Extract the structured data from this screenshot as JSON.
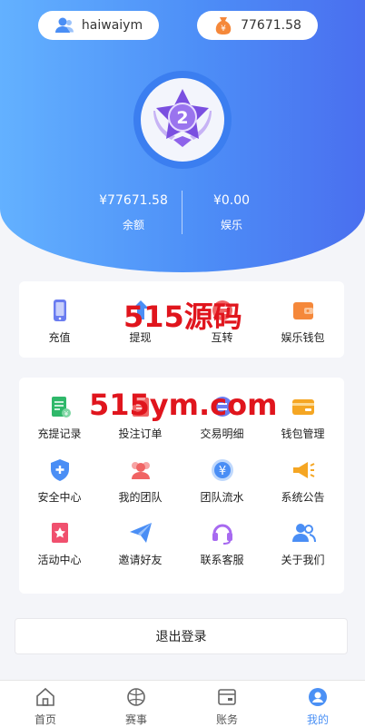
{
  "header": {
    "username": "haiwaiym",
    "balance": "77671.58"
  },
  "stats": {
    "balance_value": "¥77671.58",
    "balance_label": "余额",
    "ent_value": "¥0.00",
    "ent_label": "娱乐"
  },
  "medal": {
    "level": "2"
  },
  "quick_actions": [
    {
      "label": "充值",
      "icon": "phone-icon",
      "color": "#6a7cf0"
    },
    {
      "label": "提现",
      "icon": "withdraw-icon",
      "color": "#4a8ef5"
    },
    {
      "label": "互转",
      "icon": "transfer-icon",
      "color": "#f06464"
    },
    {
      "label": "娱乐钱包",
      "icon": "wallet-icon",
      "color": "#f5883a"
    }
  ],
  "menu": [
    {
      "label": "充提记录",
      "icon": "record-icon",
      "color": "#2fb86a"
    },
    {
      "label": "投注订单",
      "icon": "order-icon",
      "color": "#f06464"
    },
    {
      "label": "交易明细",
      "icon": "transaction-icon",
      "color": "#6a7cf0"
    },
    {
      "label": "钱包管理",
      "icon": "card-icon",
      "color": "#f5a623"
    },
    {
      "label": "安全中心",
      "icon": "shield-icon",
      "color": "#4a8ef5"
    },
    {
      "label": "我的团队",
      "icon": "team-icon",
      "color": "#f06464"
    },
    {
      "label": "团队流水",
      "icon": "yen-icon",
      "color": "#4a8ef5"
    },
    {
      "label": "系统公告",
      "icon": "megaphone-icon",
      "color": "#f5a623"
    },
    {
      "label": "活动中心",
      "icon": "ribbon-icon",
      "color": "#f0506e"
    },
    {
      "label": "邀请好友",
      "icon": "paper-plane-icon",
      "color": "#4a8ef5"
    },
    {
      "label": "联系客服",
      "icon": "headset-icon",
      "color": "#a76af0"
    },
    {
      "label": "关于我们",
      "icon": "users-icon",
      "color": "#4a8ef5"
    }
  ],
  "watermarks": {
    "top": "515源码",
    "middle": "515ym.com"
  },
  "logout_label": "退出登录",
  "tabs": [
    {
      "label": "首页",
      "icon": "home-icon"
    },
    {
      "label": "赛事",
      "icon": "ball-icon"
    },
    {
      "label": "账务",
      "icon": "ledger-icon"
    },
    {
      "label": "我的",
      "icon": "profile-icon",
      "active": true
    }
  ],
  "colors": {
    "accent": "#4a90f5",
    "hero_start": "#63b1ff",
    "hero_end": "#4a6fef",
    "watermark": "#e0151d"
  }
}
